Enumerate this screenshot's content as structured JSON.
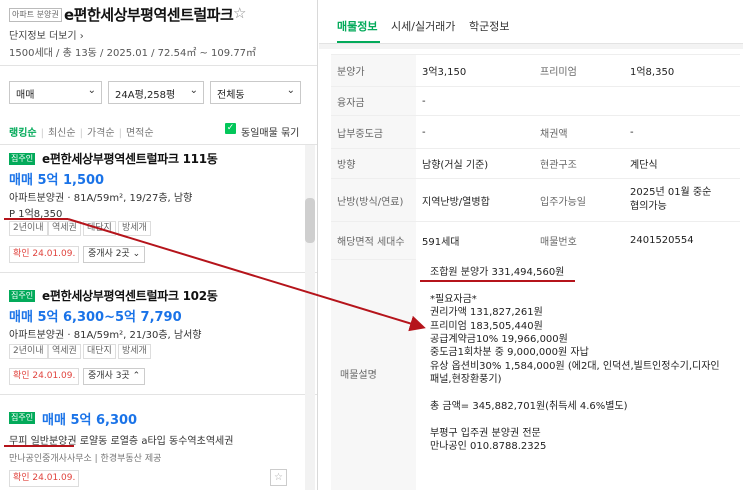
{
  "header": {
    "tag": "아파트 분양권",
    "title": "e편한세상부평역센트럴파크",
    "complex_link": "단지정보 더보기",
    "info": "1500세대 / 총 13동 / 2025.01 / 72.54㎡ ~ 109.77㎡"
  },
  "filters": {
    "trade_type": "매매",
    "area": "24A평,258평",
    "building": "전체동"
  },
  "sort": {
    "items": [
      "랭킹순",
      "최신순",
      "가격순",
      "면적순"
    ],
    "group_label": "동일매물 묶기"
  },
  "listings": [
    {
      "badge": "집주인",
      "title": "e편한세상부평역센트럴파크 111동",
      "price": "매매 5억 1,500",
      "spec": "아파트분양권 · 81A/59m², 19/27층, 남향",
      "premium": "P 1억8,350",
      "tags": [
        "2년이내",
        "역세권",
        "대단지",
        "방세개"
      ],
      "confirm": "확인 24.01.09.",
      "agents": "중개사 2곳"
    },
    {
      "badge": "집주인",
      "title": "e편한세상부평역센트럴파크 102동",
      "price": "매매 5억 6,300~5억 7,790",
      "spec": "아파트분양권 · 81A/59m², 21/30층, 남서향",
      "tags": [
        "2년이내",
        "역세권",
        "대단지",
        "방세개"
      ],
      "confirm": "확인 24.01.09.",
      "agents": "중개사 3곳"
    },
    {
      "badge": "집주인",
      "price": "매매 5억 6,300",
      "spec": "무피 일반분양권 로얄동 로열층 a타입 동수역초역세권",
      "source": "만나공인중개사사무소 | 한경부동산 제공",
      "confirm": "확인 24.01.09."
    }
  ],
  "tabs": [
    "매물정보",
    "시세/실거래가",
    "학군정보"
  ],
  "info_rows": [
    {
      "k1": "분양가",
      "v1": "3억3,150",
      "k2": "프리미엄",
      "v2": "1억8,350"
    },
    {
      "k1": "융자금",
      "v1": "-",
      "k2": "",
      "v2": ""
    },
    {
      "k1": "납부중도금",
      "v1": "-",
      "k2": "채권액",
      "v2": "-"
    },
    {
      "k1": "방향",
      "v1": "남향(거실 기준)",
      "k2": "현관구조",
      "v2": "계단식"
    },
    {
      "k1": "난방(방식/연료)",
      "v1": "지역난방/열병합",
      "k2": "입주가능일",
      "v2": "2025년 01월 중순\n협의가능"
    },
    {
      "k1": "해당면적 세대수",
      "v1": "591세대",
      "k2": "매물번호",
      "v2": "2401520554"
    }
  ],
  "description_label": "매물설명",
  "description": "조합원 분양가 331,494,560원\n\n*필요자금*\n권리가액 131,827,261원\n프리미엄 183,505,440원\n공급계약금10% 19,966,000원\n중도금1회차분 중 9,000,000원 자납\n유상 옵션비30% 1,584,000원 (에2대, 인덕션,빌트인정수기,디자인\n패널,현장환풍기)\n\n총 금액= 345,882,701원(취득세 4.6%별도)\n\n부평구 입주권 분양권 전문\n만나공인 010.8788.2325",
  "colors": {
    "accent": "#03aa5a",
    "price": "#1a73e8",
    "annotation": "#b5141b"
  }
}
